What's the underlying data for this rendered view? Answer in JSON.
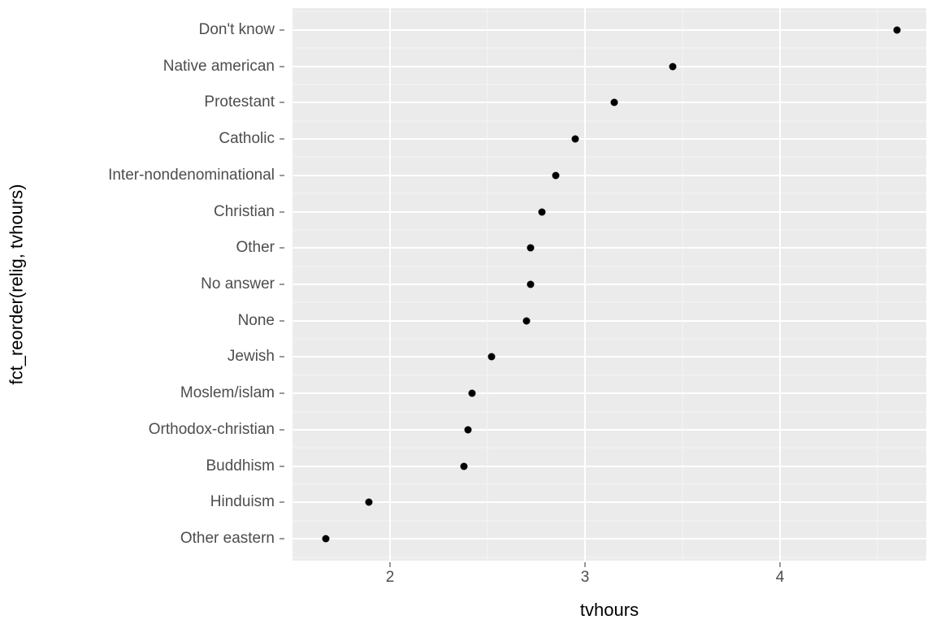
{
  "chart_data": {
    "type": "scatter",
    "xlabel": "tvhours",
    "ylabel": "fct_reorder(relig, tvhours)",
    "x_ticks": [
      2,
      3,
      4
    ],
    "x_range": [
      1.5,
      4.75
    ],
    "categories_top_to_bottom": [
      "Don't know",
      "Native american",
      "Protestant",
      "Catholic",
      "Inter-nondenominational",
      "Christian",
      "Other",
      "No answer",
      "None",
      "Jewish",
      "Moslem/islam",
      "Orthodox-christian",
      "Buddhism",
      "Hinduism",
      "Other eastern"
    ],
    "values_top_to_bottom": [
      4.6,
      3.45,
      3.15,
      2.95,
      2.85,
      2.78,
      2.72,
      2.72,
      2.7,
      2.52,
      2.42,
      2.4,
      2.38,
      1.89,
      1.67
    ],
    "series": [
      {
        "category": "Don't know",
        "value": 4.6
      },
      {
        "category": "Native american",
        "value": 3.45
      },
      {
        "category": "Protestant",
        "value": 3.15
      },
      {
        "category": "Catholic",
        "value": 2.95
      },
      {
        "category": "Inter-nondenominational",
        "value": 2.85
      },
      {
        "category": "Christian",
        "value": 2.78
      },
      {
        "category": "Other",
        "value": 2.72
      },
      {
        "category": "No answer",
        "value": 2.72
      },
      {
        "category": "None",
        "value": 2.7
      },
      {
        "category": "Jewish",
        "value": 2.52
      },
      {
        "category": "Moslem/islam",
        "value": 2.42
      },
      {
        "category": "Orthodox-christian",
        "value": 2.4
      },
      {
        "category": "Buddhism",
        "value": 2.38
      },
      {
        "category": "Hinduism",
        "value": 1.89
      },
      {
        "category": "Other eastern",
        "value": 1.67
      }
    ]
  }
}
